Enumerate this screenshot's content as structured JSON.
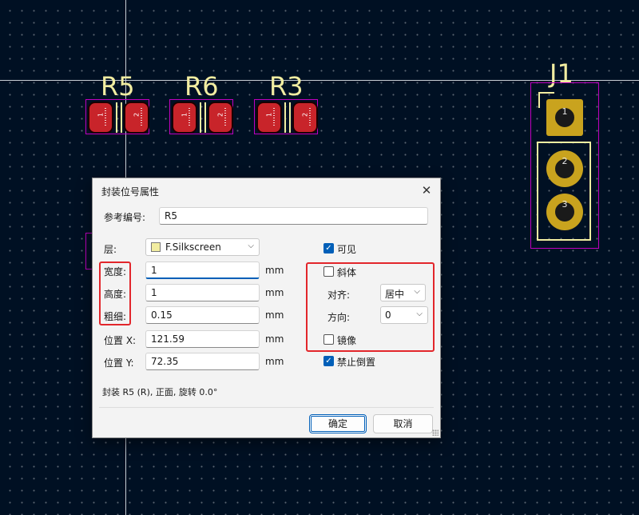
{
  "board": {
    "refs": [
      "R5",
      "R6",
      "R3"
    ],
    "connector_ref": "J1",
    "pad_numbers": [
      "1",
      "2"
    ],
    "connector_pins": [
      "1",
      "2",
      "3"
    ]
  },
  "dialog": {
    "title": "封装位号属性",
    "close_glyph": "✕",
    "reference_label": "参考编号:",
    "reference_value": "R5",
    "layer_label": "层:",
    "layer_value": "F.Silkscreen",
    "width_label": "宽度:",
    "width_value": "1",
    "height_label": "高度:",
    "height_value": "1",
    "thickness_label": "粗细:",
    "thickness_value": "0.15",
    "pos_x_label": "位置 X:",
    "pos_x_value": "121.59",
    "pos_y_label": "位置 Y:",
    "pos_y_value": "72.35",
    "unit": "mm",
    "visible_label": "可见",
    "visible_checked": true,
    "italic_label": "斜体",
    "italic_checked": false,
    "align_label": "对齐:",
    "align_value": "居中",
    "orient_label": "方向:",
    "orient_value": "0",
    "mirror_label": "镜像",
    "mirror_checked": false,
    "keep_upright_label": "禁止倒置",
    "keep_upright_checked": true,
    "footprint_info": "封装 R5 (R), 正面, 旋转 0.0°",
    "ok_label": "确定",
    "cancel_label": "取消",
    "check_glyph": "✓",
    "chevron_glyph": "⌵"
  },
  "colors": {
    "canvas_bg": "#001023",
    "silkscreen": "#f2eda1",
    "pad": "#c8242a",
    "courtyard": "#c000c0",
    "highlight": "#e2262b",
    "accent": "#005fb8"
  }
}
